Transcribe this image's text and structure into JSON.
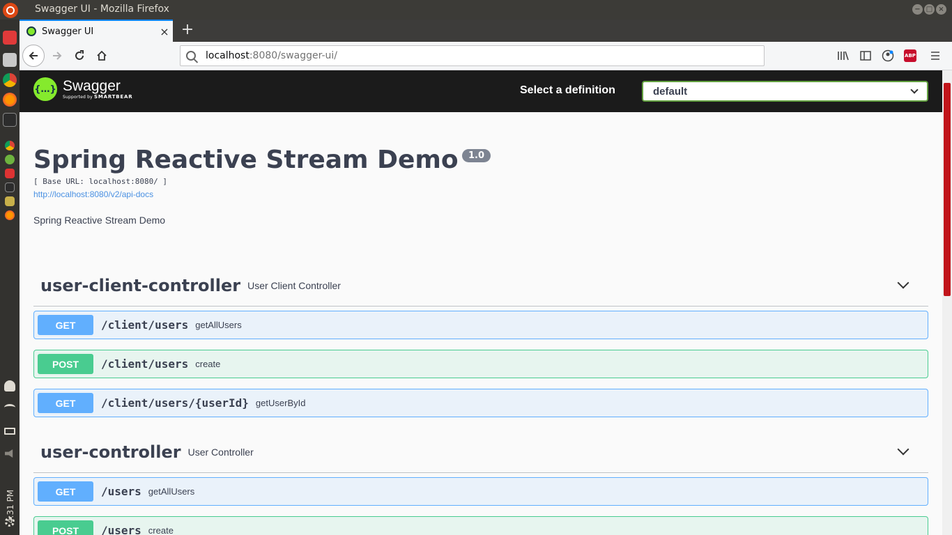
{
  "window": {
    "title": "Swagger UI - Mozilla Firefox",
    "controls": [
      "−",
      "□",
      "×"
    ]
  },
  "launcher": {
    "clock": "4:31 PM"
  },
  "browser": {
    "tab_title": "Swagger UI",
    "tab_close": "×",
    "new_tab": "+",
    "url_host": "localhost",
    "url_rest": ":8080/swagger-ui/",
    "abp_label": "ABP"
  },
  "swagger": {
    "logo_word": "Swagger",
    "logo_mark": "{…}",
    "logo_sub_prefix": "Supported by",
    "logo_sub_brand": "SMARTBEAR",
    "definition_label": "Select a definition",
    "definition_value": "default",
    "info": {
      "title": "Spring Reactive Stream Demo",
      "version": "1.0",
      "base_url": "[ Base URL: localhost:8080/ ]",
      "docs_link": "http://localhost:8080/v2/api-docs",
      "description": "Spring Reactive Stream Demo"
    },
    "tags": [
      {
        "name": "user-client-controller",
        "description": "User Client Controller",
        "operations": [
          {
            "method": "GET",
            "path": "/client/users",
            "summary": "getAllUsers"
          },
          {
            "method": "POST",
            "path": "/client/users",
            "summary": "create"
          },
          {
            "method": "GET",
            "path": "/client/users/{userId}",
            "summary": "getUserById"
          }
        ]
      },
      {
        "name": "user-controller",
        "description": "User Controller",
        "operations": [
          {
            "method": "GET",
            "path": "/users",
            "summary": "getAllUsers"
          },
          {
            "method": "POST",
            "path": "/users",
            "summary": "create"
          }
        ]
      }
    ]
  }
}
